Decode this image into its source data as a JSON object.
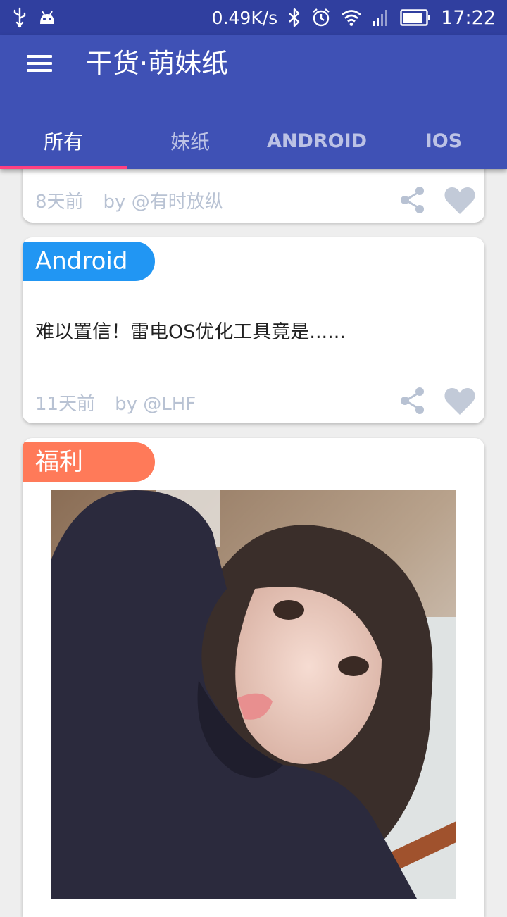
{
  "status_bar": {
    "speed": "0.49K/s",
    "time": "17:22",
    "icons": [
      "usb-icon",
      "android-debug-icon",
      "bluetooth-icon",
      "alarm-icon",
      "wifi-icon",
      "signal-icon",
      "battery-icon"
    ]
  },
  "app_bar": {
    "title": "干货·萌妹纸",
    "menu_icon": "menu-icon"
  },
  "tabs": [
    {
      "label": "所有",
      "active": true
    },
    {
      "label": "妹纸",
      "active": false
    },
    {
      "label": "ANDROID",
      "active": false
    },
    {
      "label": "IOS",
      "active": false
    }
  ],
  "cards": [
    {
      "time": "8天前",
      "author": "by @有时放纵"
    },
    {
      "tag": "Android",
      "tag_color": "#2196f3",
      "description": "难以置信！雷电OS优化工具竟是......",
      "time": "11天前",
      "author": "by @LHF"
    },
    {
      "tag": "福利",
      "tag_color": "#ff7a59"
    }
  ],
  "colors": {
    "primary": "#3f51b5",
    "primary_dark": "#303f9f",
    "accent": "#ff4081",
    "meta_text": "#b8c2d3"
  }
}
